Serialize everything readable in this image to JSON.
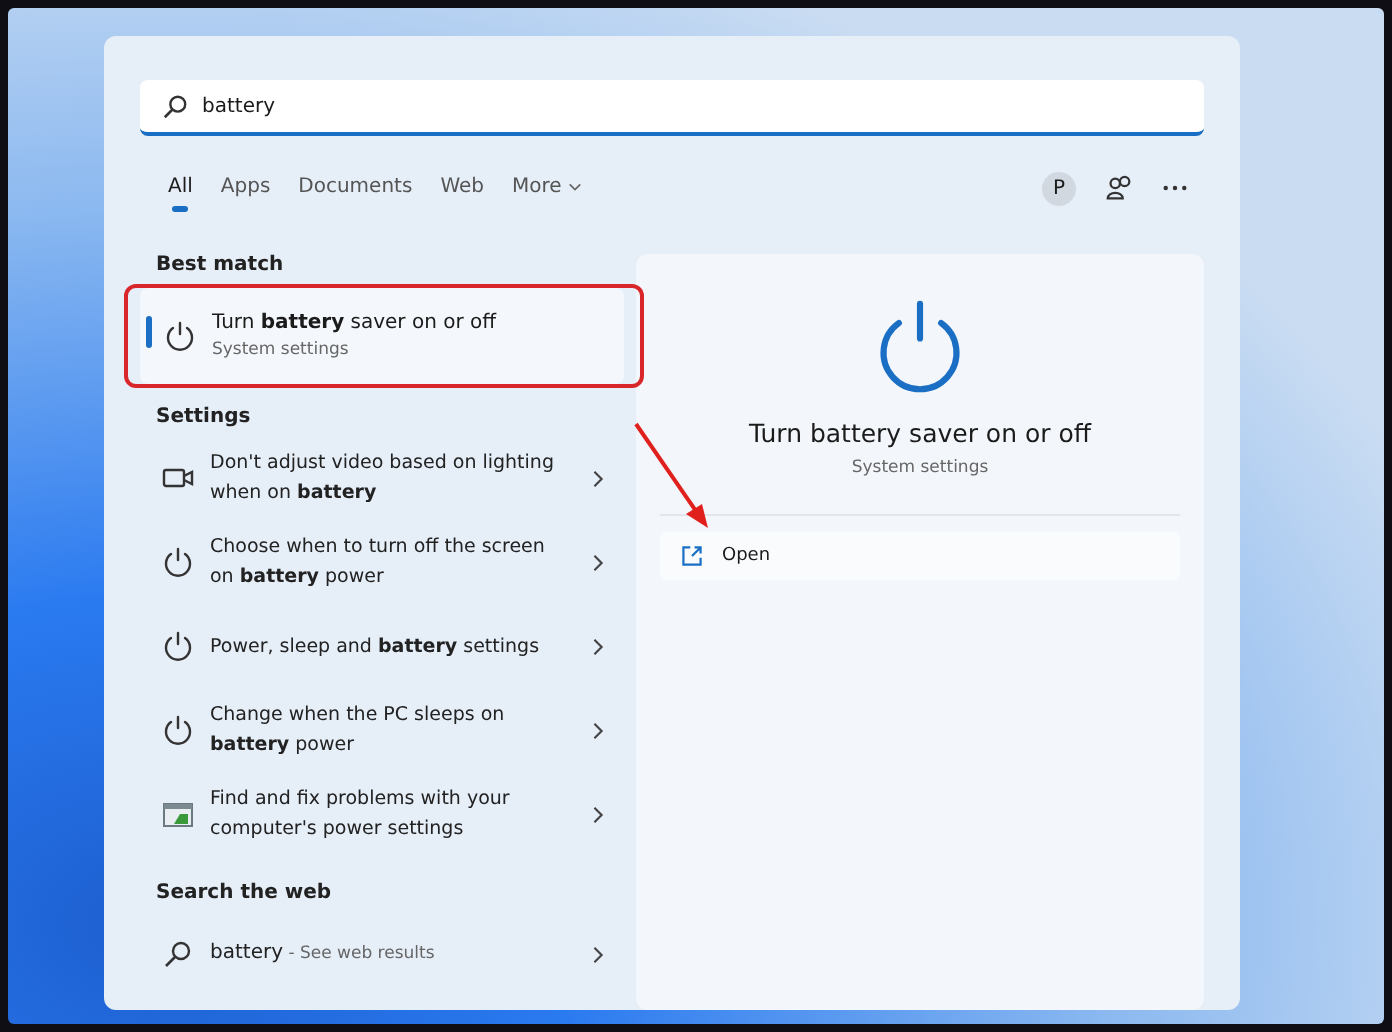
{
  "search": {
    "value": "battery"
  },
  "tabs": [
    {
      "label": "All",
      "selected": true
    },
    {
      "label": "Apps",
      "selected": false
    },
    {
      "label": "Documents",
      "selected": false
    },
    {
      "label": "Web",
      "selected": false
    },
    {
      "label": "More",
      "selected": false,
      "dropdown": true
    }
  ],
  "account": {
    "initial": "P"
  },
  "best_match": {
    "heading": "Best match",
    "title": "Turn **battery** saver on or off",
    "subtitle": "System settings",
    "selected": true,
    "kind": "power"
  },
  "settings": {
    "heading": "Settings",
    "items": [
      {
        "kind": "video",
        "text": "Don't adjust video based on lighting when on **battery**"
      },
      {
        "kind": "power",
        "text": "Choose when to turn off the screen on **battery** power"
      },
      {
        "kind": "power",
        "text": "Power, sleep and **battery** settings"
      },
      {
        "kind": "power",
        "text": "Change when the PC sleeps on **battery** power"
      },
      {
        "kind": "troubleshoot",
        "text": "Find and fix problems with your computer's power settings"
      }
    ]
  },
  "web": {
    "heading": "Search the web",
    "query": "battery",
    "hint": " - See web results"
  },
  "preview": {
    "title": "Turn battery saver on or off",
    "subtitle": "System settings",
    "actions": [
      {
        "label": "Open"
      }
    ]
  }
}
